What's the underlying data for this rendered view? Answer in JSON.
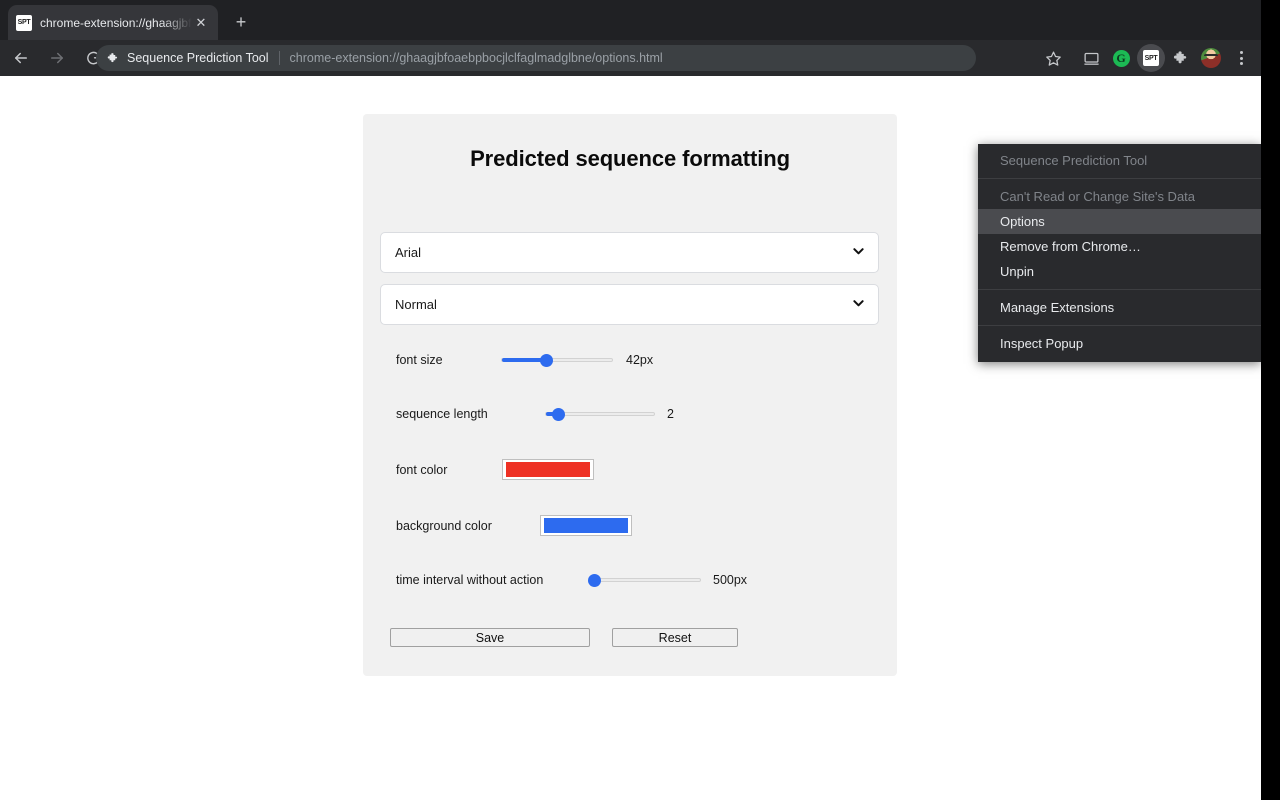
{
  "browser": {
    "tab": {
      "favicon_text": "SPT",
      "title": "chrome-extension://ghaagjbfo",
      "close_label": "✕",
      "newtab_label": "+"
    },
    "nav": {
      "back_icon": "arrow-left-icon",
      "forward_icon": "arrow-right-icon",
      "reload_icon": "reload-icon"
    },
    "omnibox": {
      "extension_chip": "Sequence Prediction Tool",
      "url": "chrome-extension://ghaagjbfoaebpbocjlclfaglmadglbne/options.html"
    },
    "toolbar_icons": {
      "bookmark": "star-icon",
      "cast": "cast-icon",
      "grammarly_letter": "G",
      "extension_badge": "SPT",
      "extensions": "puzzle-icon",
      "profile": "avatar",
      "menu": "three-dot-menu-icon"
    }
  },
  "page": {
    "title": "Predicted sequence formatting",
    "font_select": {
      "value": "Arial",
      "chevron": "⌄"
    },
    "style_select": {
      "value": "Normal",
      "chevron": "⌄"
    },
    "sliders": [
      {
        "label": "font size",
        "value": "42px",
        "percent": 40
      },
      {
        "label": "sequence length",
        "value": "2",
        "percent": 12
      },
      {
        "label": "time interval without action",
        "value": "500px",
        "percent": 0
      }
    ],
    "colors": [
      {
        "label": "font color",
        "value": "#EE3124"
      },
      {
        "label": "background color",
        "value": "#2D6BEF"
      }
    ],
    "buttons": {
      "save": "Save",
      "reset": "Reset"
    }
  },
  "context_menu": {
    "items": [
      {
        "label": "Sequence Prediction Tool",
        "state": "disabled"
      },
      {
        "label": "Can't Read or Change Site's Data",
        "state": "disabled"
      },
      {
        "label": "Options",
        "state": "highlighted"
      },
      {
        "label": "Remove from Chrome…",
        "state": "normal"
      },
      {
        "label": "Unpin",
        "state": "normal"
      },
      {
        "label": "Manage Extensions",
        "state": "normal"
      },
      {
        "label": "Inspect Popup",
        "state": "normal"
      }
    ]
  }
}
